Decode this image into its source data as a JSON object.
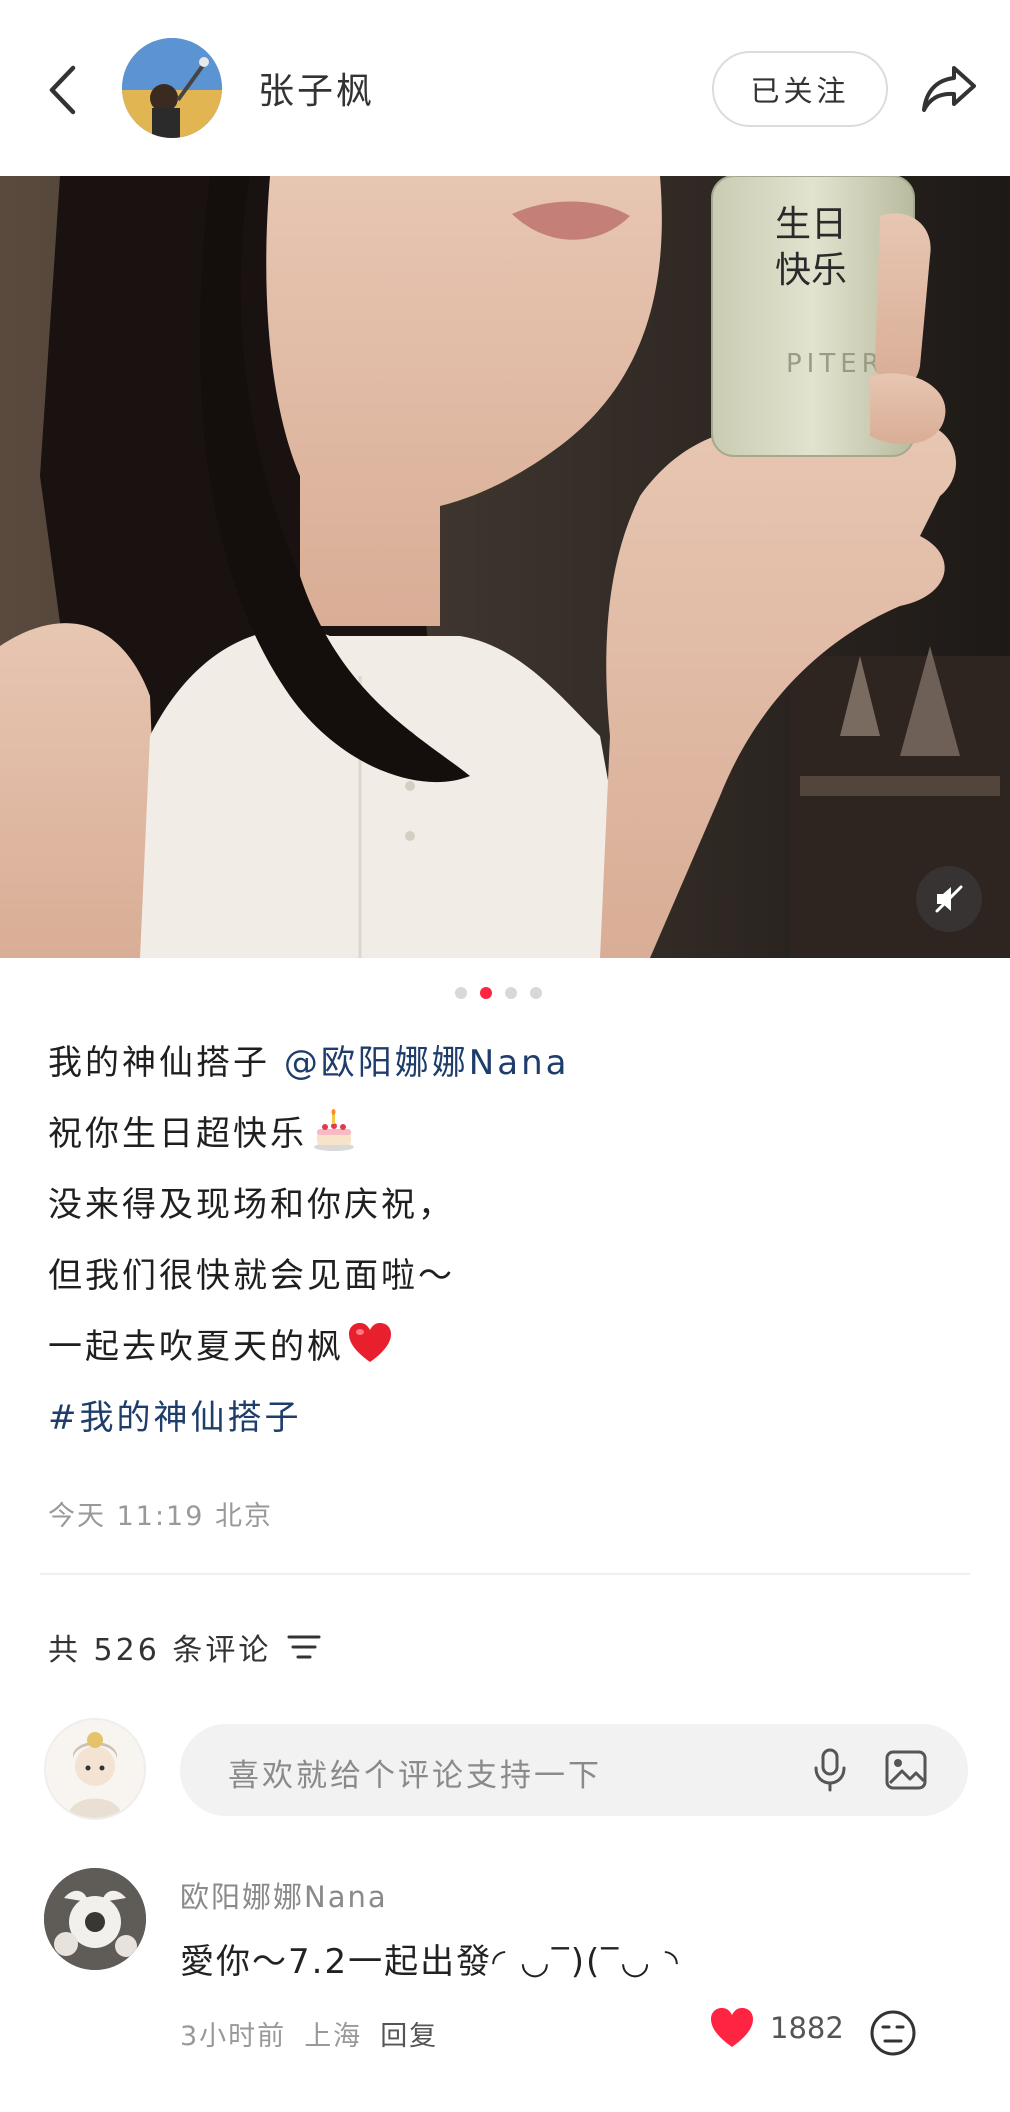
{
  "header": {
    "author_name": "张子枫",
    "follow_label": "已关注"
  },
  "carousel": {
    "total": 4,
    "active_index": 1
  },
  "post": {
    "caption": {
      "line1_text": "我的神仙搭子",
      "line1_mention": "@欧阳娜娜Nana",
      "line2": "祝你生日超快乐",
      "line3": "没来得及现场和你庆祝，",
      "line4": "但我们很快就会见面啦～",
      "line5": "一起去吹夏天的枫",
      "hashtag": "#我的神仙搭子"
    },
    "bottle_text_1": "生日",
    "bottle_text_2": "快乐",
    "bottle_brand": "PITERA",
    "meta": "今天 11:19 北京"
  },
  "comments": {
    "count_label": "共 526 条评论",
    "input_placeholder": "喜欢就给个评论支持一下",
    "items": [
      {
        "user": "欧阳娜娜Nana",
        "text": "愛你～7.2一起出發◜ ◡‾)(‾◡ ◝",
        "time": "3小时前",
        "location": "上海",
        "reply_label": "回复",
        "likes": "1882"
      }
    ]
  },
  "colors": {
    "accent": "#ff2442",
    "link": "#1e3d6b",
    "muted": "#999999"
  },
  "icons": [
    "back-arrow-icon",
    "share-icon",
    "mute-icon",
    "cake-emoji",
    "heart-emoji",
    "sort-icon",
    "mic-icon",
    "image-icon",
    "heart-icon",
    "emoji-icon"
  ]
}
